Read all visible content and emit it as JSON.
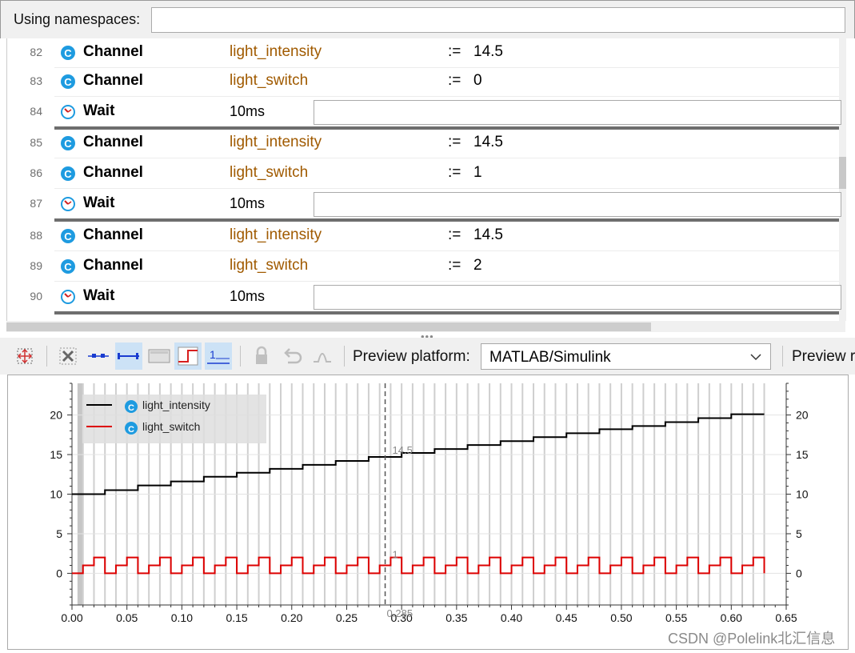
{
  "namespaces": {
    "label": "Using namespaces:",
    "value": ""
  },
  "steps": [
    {
      "num": "82",
      "type": "Channel",
      "icon": "channel-icon",
      "name": "light_intensity",
      "assign": ":=",
      "value": "14.5"
    },
    {
      "num": "83",
      "type": "Channel",
      "icon": "channel-icon",
      "name": "light_switch",
      "assign": ":=",
      "value": "0"
    },
    {
      "num": "84",
      "type": "Wait",
      "icon": "wait-clock-icon",
      "value": "10ms"
    },
    {
      "num": "85",
      "type": "Channel",
      "icon": "channel-icon",
      "name": "light_intensity",
      "assign": ":=",
      "value": "14.5"
    },
    {
      "num": "86",
      "type": "Channel",
      "icon": "channel-icon",
      "name": "light_switch",
      "assign": ":=",
      "value": "1"
    },
    {
      "num": "87",
      "type": "Wait",
      "icon": "wait-clock-icon",
      "value": "10ms"
    },
    {
      "num": "88",
      "type": "Channel",
      "icon": "channel-icon",
      "name": "light_intensity",
      "assign": ":=",
      "value": "14.5"
    },
    {
      "num": "89",
      "type": "Channel",
      "icon": "channel-icon",
      "name": "light_switch",
      "assign": ":=",
      "value": "2"
    },
    {
      "num": "90",
      "type": "Wait",
      "icon": "wait-clock-icon",
      "value": "10ms"
    }
  ],
  "toolbar": {
    "preview_platform_label": "Preview platform:",
    "platform_value": "MATLAB/Simulink",
    "preview_more_label": "Preview r"
  },
  "chart_data": {
    "type": "line",
    "xlim": [
      0.0,
      0.65
    ],
    "ylim": [
      -4,
      24
    ],
    "x_ticks": [
      "0.00",
      "0.05",
      "0.10",
      "0.15",
      "0.20",
      "0.25",
      "0.30",
      "0.35",
      "0.40",
      "0.45",
      "0.50",
      "0.55",
      "0.60",
      "0.65"
    ],
    "y_ticks": [
      "0",
      "5",
      "10",
      "15",
      "20"
    ],
    "cursor": {
      "x": 0.285,
      "x_label": "0.285",
      "y1_label": "14.5",
      "y2_label": "1"
    },
    "legend_position": "top-left",
    "series": [
      {
        "name": "light_intensity",
        "color": "#000000",
        "x": [
          0.0,
          0.03,
          0.06,
          0.09,
          0.12,
          0.15,
          0.18,
          0.21,
          0.24,
          0.27,
          0.3,
          0.33,
          0.36,
          0.39,
          0.42,
          0.45,
          0.48,
          0.51,
          0.54,
          0.57,
          0.6,
          0.63
        ],
        "y": [
          10.0,
          10.5,
          11.1,
          11.6,
          12.2,
          12.7,
          13.2,
          13.7,
          14.2,
          14.7,
          15.2,
          15.7,
          16.2,
          16.7,
          17.2,
          17.7,
          18.2,
          18.6,
          19.1,
          19.6,
          20.1,
          20.1
        ]
      },
      {
        "name": "light_switch",
        "color": "#dd0000",
        "x_step": 0.01,
        "x_start": 0.0,
        "x_end": 0.63,
        "pattern": [
          0,
          1,
          2
        ]
      }
    ]
  },
  "watermark": "CSDN @Polelink北汇信息"
}
